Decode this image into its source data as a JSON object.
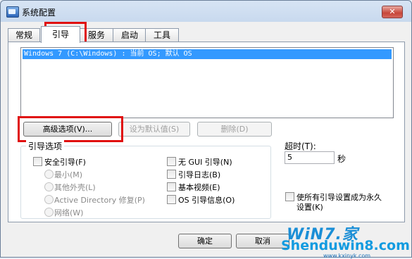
{
  "window": {
    "title": "系统配置",
    "close_label": "✕"
  },
  "tabs": [
    "常规",
    "引导",
    "服务",
    "启动",
    "工具"
  ],
  "os_list": [
    "Windows 7 (C:\\Windows) : 当前 OS; 默认 OS"
  ],
  "buttons": {
    "advanced": "高级选项(V)...",
    "set_default": "设为默认值(S)",
    "delete": "删除(D)",
    "ok": "确定",
    "cancel": "取消"
  },
  "boot_options": {
    "title": "引导选项",
    "safe_boot": "安全引导(F)",
    "minimal": "最小(M)",
    "alternate_shell": "其他外壳(L)",
    "ad_repair": "Active Directory 修复(P)",
    "network": "网络(W)",
    "no_gui": "无 GUI 引导(N)",
    "boot_log": "引导日志(B)",
    "base_video": "基本视频(E)",
    "os_boot_info": "OS 引导信息(O)"
  },
  "timeout": {
    "label": "超时(T):",
    "value": "5",
    "unit": "秒"
  },
  "permanent": {
    "line1": "使所有引导设置成为永久",
    "line2": "设置(K)"
  },
  "watermark": {
    "brand": "WiN7.家",
    "site": "Shenduwin8.com",
    "url": "www.kxinyk.com"
  }
}
